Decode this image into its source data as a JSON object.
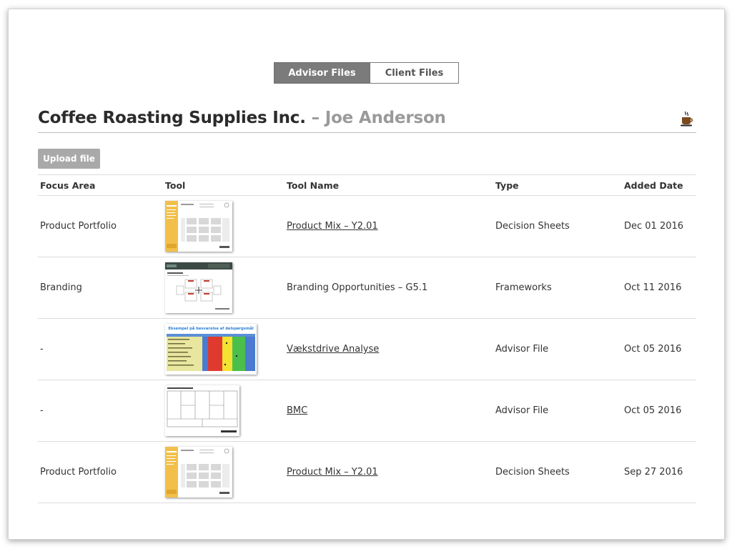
{
  "tabs": [
    {
      "label": "Advisor Files",
      "active": true
    },
    {
      "label": "Client Files",
      "active": false
    }
  ],
  "header": {
    "company": "Coffee Roasting Supplies Inc.",
    "separator": "–",
    "person": "Joe Anderson",
    "icon": "coffee-cup-icon"
  },
  "upload_label": "Upload file",
  "columns": [
    "Focus Area",
    "Tool",
    "Tool Name",
    "Type",
    "Added Date"
  ],
  "rows": [
    {
      "focus": "Product Portfolio",
      "tool_thumb": "product-mix-thumbnail",
      "name": "Product Mix – Y2.01",
      "name_link": true,
      "type": "Decision Sheets",
      "date": "Dec 01 2016"
    },
    {
      "focus": "Branding",
      "tool_thumb": "branding-opportunities-thumbnail",
      "name": "Branding Opportunities – G5.1",
      "name_link": false,
      "type": "Frameworks",
      "date": "Oct 11 2016"
    },
    {
      "focus": "-",
      "tool_thumb": "vaekstdrive-thumbnail",
      "thumb_title": "Eksempel på besvarelse af delspørgsmål",
      "name": "Vækstdrive Analyse",
      "name_link": true,
      "type": "Advisor File",
      "date": "Oct 05 2016"
    },
    {
      "focus": "-",
      "tool_thumb": "bmc-thumbnail",
      "name": "BMC",
      "name_link": true,
      "type": "Advisor File",
      "date": "Oct 05 2016"
    },
    {
      "focus": "Product Portfolio",
      "tool_thumb": "product-mix-thumbnail",
      "name": "Product Mix – Y2.01",
      "name_link": true,
      "type": "Decision Sheets",
      "date": "Sep 27 2016"
    }
  ]
}
